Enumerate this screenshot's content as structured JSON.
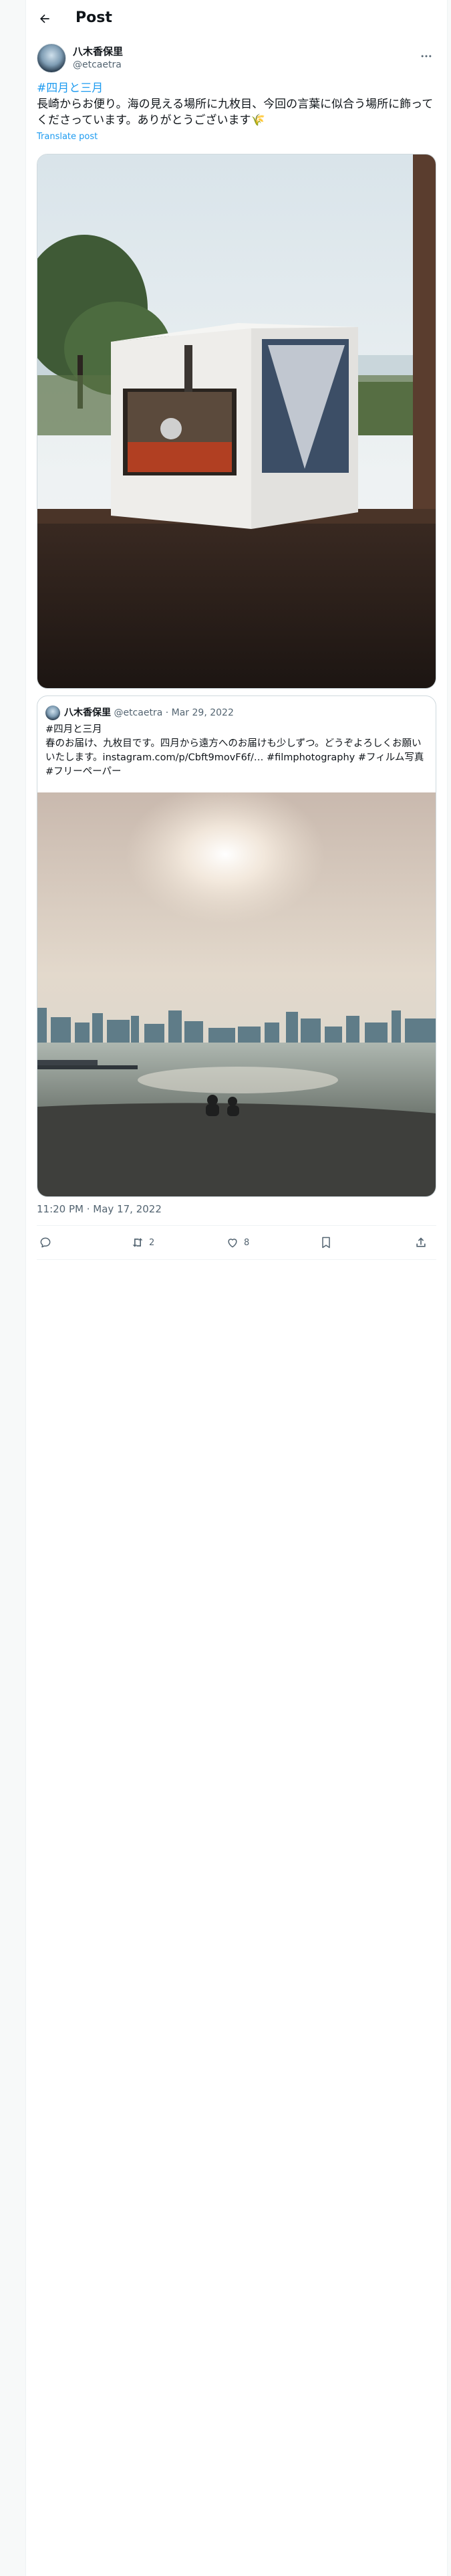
{
  "header": {
    "title": "Post"
  },
  "author": {
    "name": "八木香保里",
    "handle": "@etcaetra"
  },
  "tweet": {
    "hashtag": "#四月と三月",
    "text": "長崎からお便り。海の見える場所に九枚目、今回の言葉に似合う場所に飾ってくださっています。ありがとうございます🌾",
    "translate_label": "Translate post"
  },
  "quote": {
    "name": "八木香保里",
    "handle": "@etcaetra",
    "separator": "·",
    "date": "Mar 29, 2022",
    "text_line1": "#四月と三月",
    "text_body": "春のお届け、九枚目です。四月から遠方へのお届けも少しずつ。どうぞよろしくお願いいたします。instagram.com/p/Cbft9movF6f/… #filmphotography #フィルム写真 #フリーペーパー"
  },
  "timestamp": "11:20 PM · May 17, 2022",
  "actions": {
    "reply_count": "",
    "repost_count": "2",
    "like_count": "8"
  },
  "icons": {
    "back": "back-arrow-icon",
    "more": "more-icon",
    "reply": "reply-icon",
    "repost": "repost-icon",
    "like": "heart-icon",
    "bookmark": "bookmark-icon",
    "share": "share-icon"
  },
  "colors": {
    "accent": "#1d9bf0",
    "muted": "#536471",
    "text": "#0f1419",
    "border": "#cfd9de"
  }
}
